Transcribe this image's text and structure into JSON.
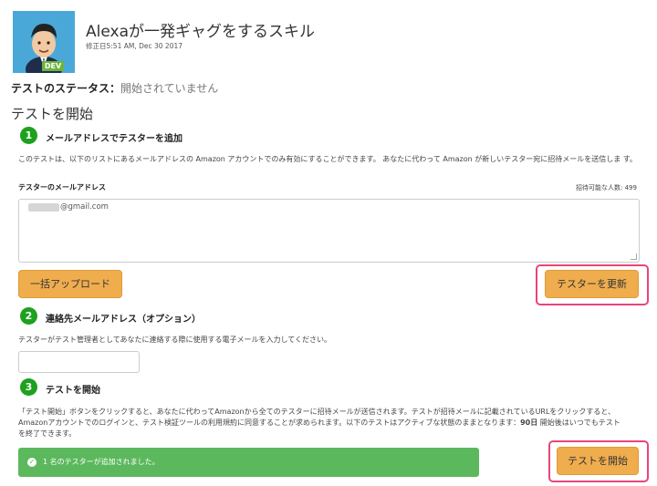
{
  "skill": {
    "title": "Alexaが一発ギャグをするスキル",
    "modified": "修正日5:51 AM, Dec 30 2017",
    "badge": "DEV"
  },
  "status": {
    "label": "テストのステータス：",
    "value": "開始されていません"
  },
  "section_title": "テストを開始",
  "step1": {
    "number": "1",
    "title": "メールアドレスでテスターを追加",
    "description": "このテストは、以下のリストにあるメールアドレスの Amazon アカウントでのみ有効にすることができます。 あなたに代わって Amazon が新しいテスター宛に招待メールを送信しま す。",
    "email_label": "テスターのメールアドレス",
    "invites_left": "招待可能な人数: 499",
    "email_value": "@gmail.com",
    "bulk_upload_label": "一括アップロード",
    "update_label": "テスターを更新"
  },
  "step2": {
    "number": "2",
    "title": "連絡先メールアドレス（オプション）",
    "description": "テスターがテスト管理者としてあなたに連絡する際に使用する電子メールを入力してください。",
    "input_value": ""
  },
  "step3": {
    "number": "3",
    "title": "テストを開始",
    "desc_line1": "「テスト開始」ボタンをクリックすると、あなたに代わってAmazonから全てのテスターに招待メールが送信されます。テストが招待メールに記載されているURLをクリックすると、",
    "desc_line2a": "Amazonアカウントでのログインと、テスト検証ツールの利用規約に同意することが求められます。以下のテストはアクティブな状態のままとなります：",
    "desc_days": "90日",
    "desc_line2b": "開始後はいつでもテスト",
    "desc_line3": "を終了できます。",
    "start_label": "テストを開始"
  },
  "alert": {
    "icon": "check-circle-icon",
    "text": "1 名のテスターが追加されました。"
  },
  "colors": {
    "accent_green": "#1ea11e",
    "button_orange": "#f0ad4e",
    "highlight_pink": "#e8457c",
    "alert_green": "#5cb85c"
  }
}
